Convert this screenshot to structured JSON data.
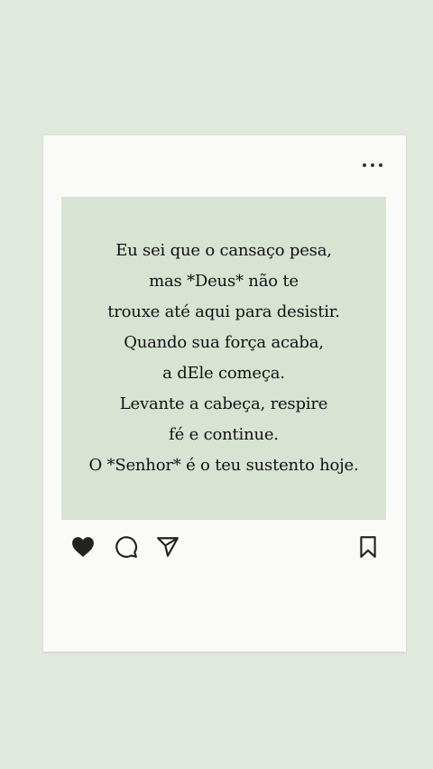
{
  "post": {
    "quote_lines": [
      "Eu sei que o cansaço pesa,",
      "mas *Deus* não te",
      "trouxe até aqui para desistir.",
      "Quando sua força acaba,",
      "a dEle começa.",
      "Levante a cabeça, respire",
      "fé e continue.",
      "O *Senhor* é o teu sustento hoje."
    ]
  },
  "icons": {
    "more": "more-options-icon",
    "like": "heart-icon",
    "comment": "comment-icon",
    "share": "send-icon",
    "save": "bookmark-icon"
  },
  "colors": {
    "page_background": "#e1e8dd",
    "card_background": "#fafaf8",
    "image_background": "#d8e3d4",
    "text": "#111111",
    "icon": "#222222"
  }
}
